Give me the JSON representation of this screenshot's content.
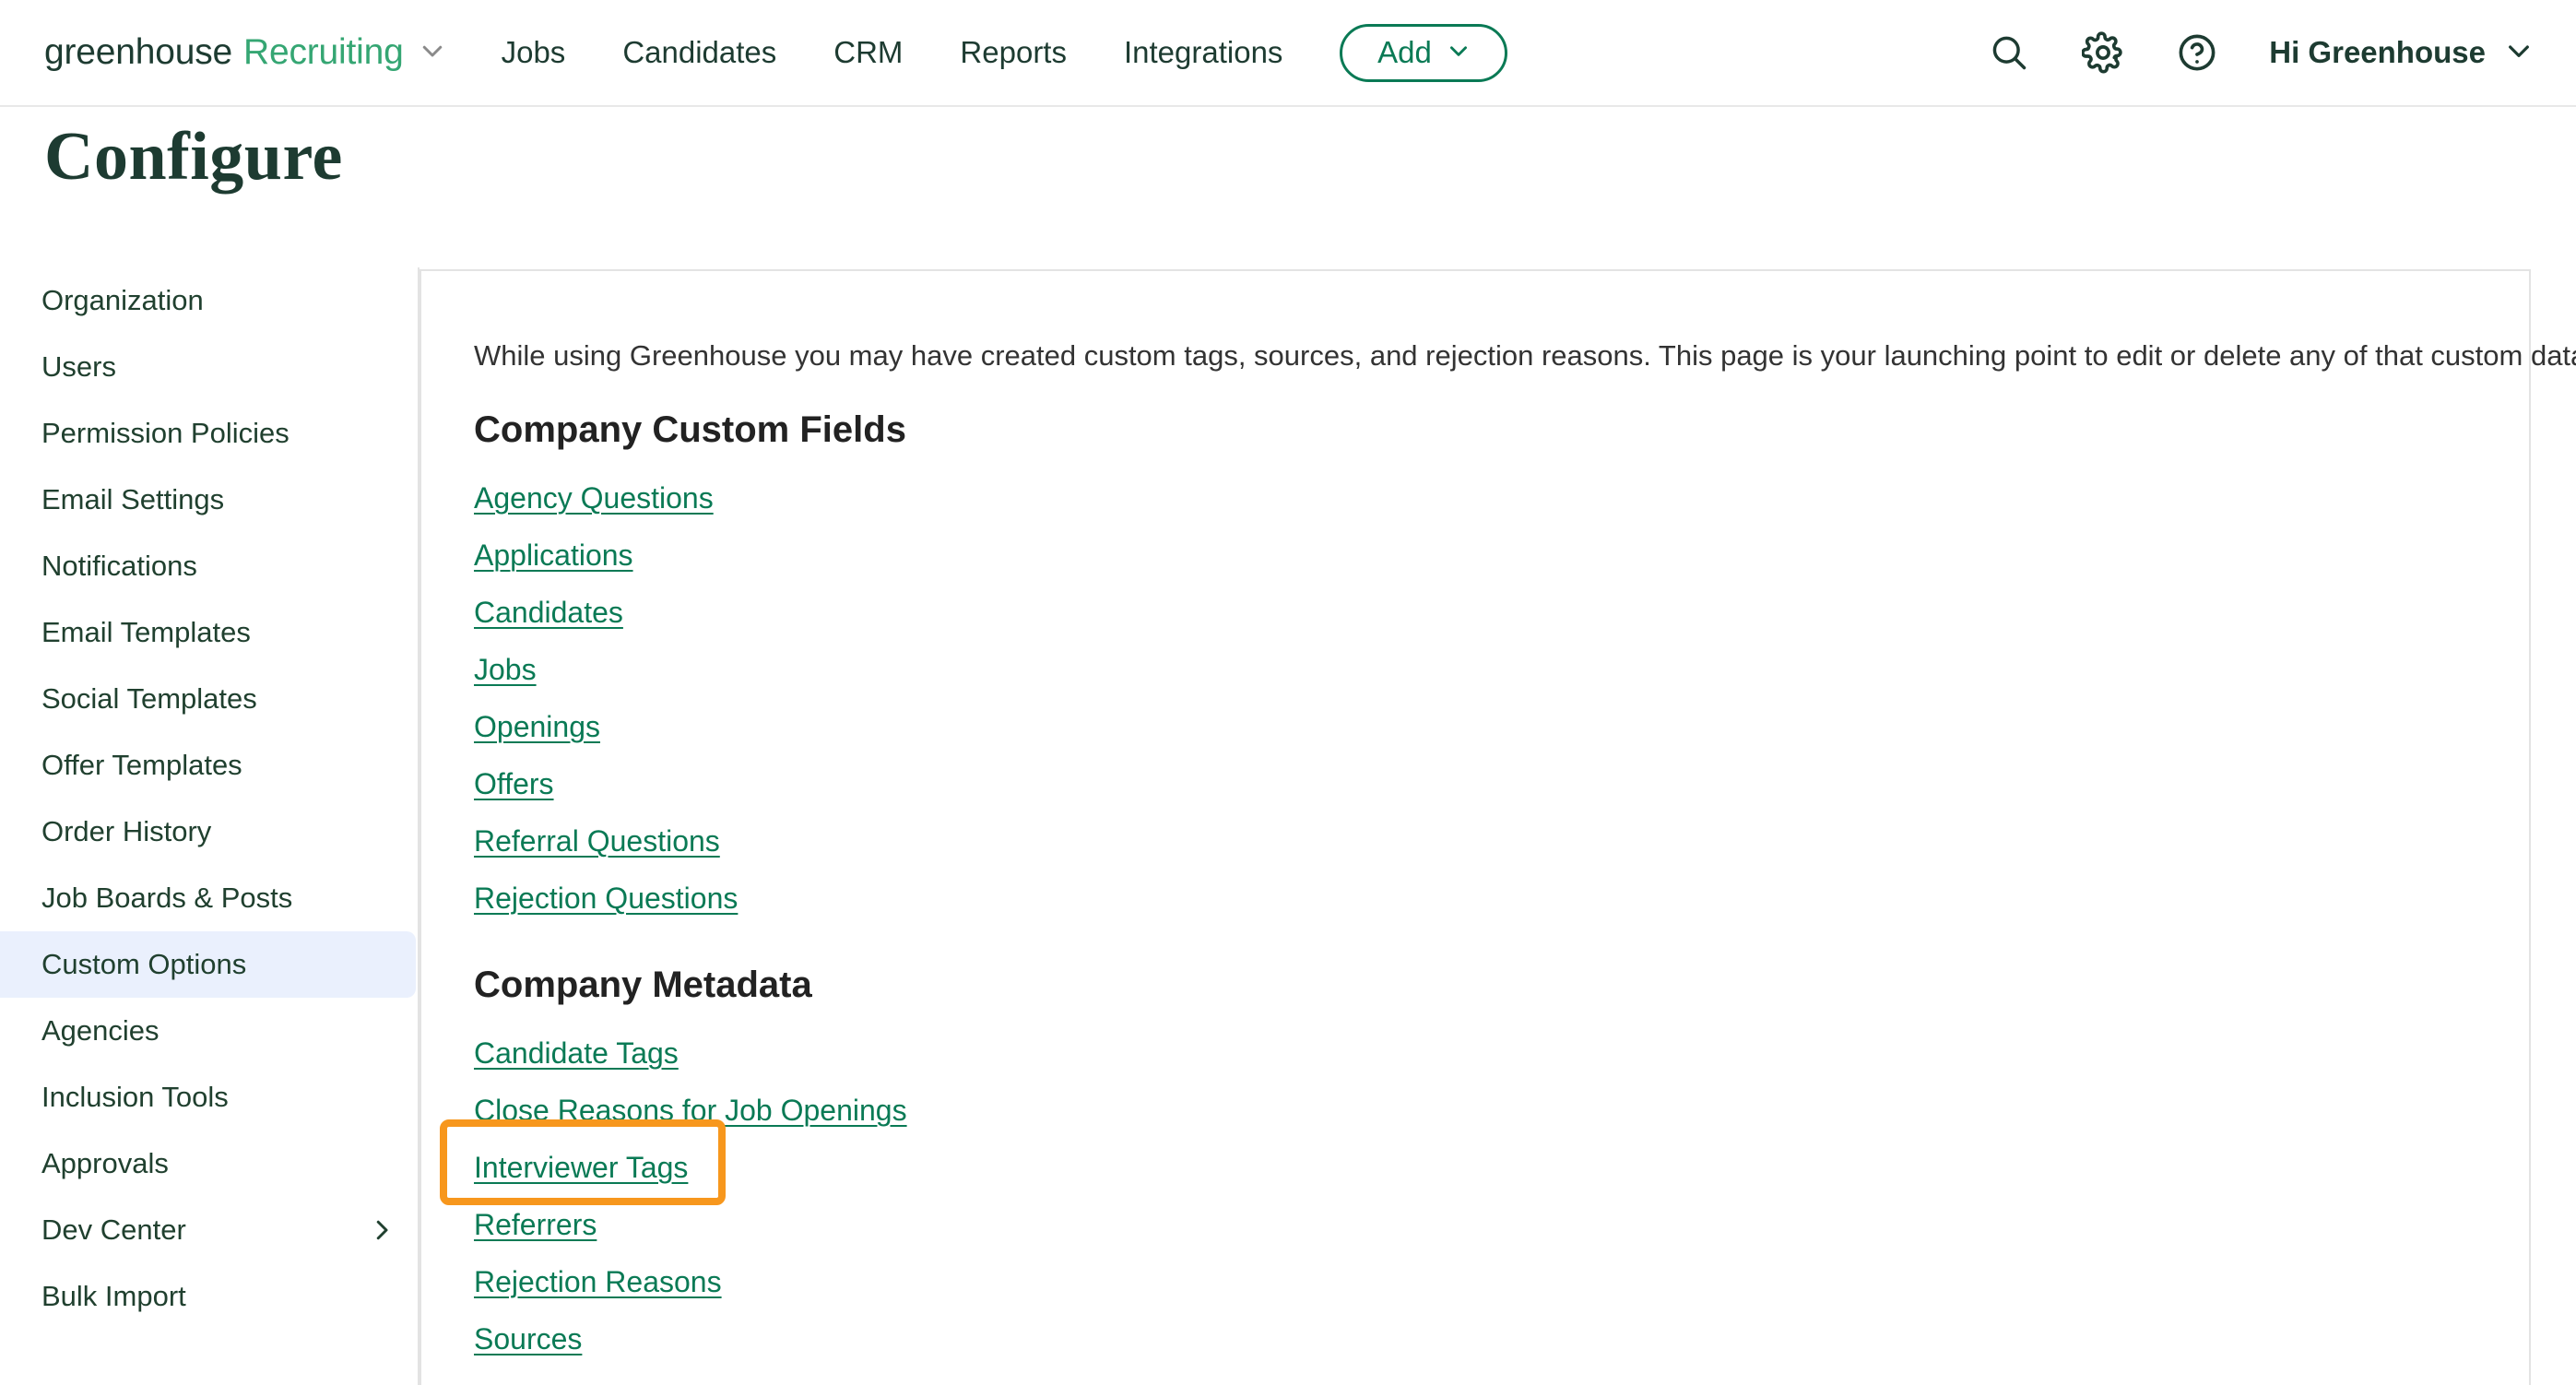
{
  "topnav": {
    "brand_primary": "greenhouse",
    "brand_secondary": "Recruiting",
    "brand_caret_icon": "chevron-down-icon",
    "links": [
      {
        "label": "Jobs"
      },
      {
        "label": "Candidates"
      },
      {
        "label": "CRM"
      },
      {
        "label": "Reports"
      },
      {
        "label": "Integrations"
      }
    ],
    "add_button": {
      "label": "Add",
      "caret_icon": "chevron-down-icon"
    },
    "search_icon": "search-icon",
    "gear_icon": "gear-icon",
    "help_icon": "question-circle-icon",
    "greeting": "Hi Greenhouse",
    "greeting_caret_icon": "chevron-down-icon"
  },
  "page": {
    "title": "Configure"
  },
  "sidebar": {
    "items": [
      {
        "label": "Organization",
        "active": false,
        "chevron": false
      },
      {
        "label": "Users",
        "active": false,
        "chevron": false
      },
      {
        "label": "Permission Policies",
        "active": false,
        "chevron": false
      },
      {
        "label": "Email Settings",
        "active": false,
        "chevron": false
      },
      {
        "label": "Notifications",
        "active": false,
        "chevron": false
      },
      {
        "label": "Email Templates",
        "active": false,
        "chevron": false
      },
      {
        "label": "Social Templates",
        "active": false,
        "chevron": false
      },
      {
        "label": "Offer Templates",
        "active": false,
        "chevron": false
      },
      {
        "label": "Order History",
        "active": false,
        "chevron": false
      },
      {
        "label": "Job Boards & Posts",
        "active": false,
        "chevron": false
      },
      {
        "label": "Custom Options",
        "active": true,
        "chevron": false
      },
      {
        "label": "Agencies",
        "active": false,
        "chevron": false
      },
      {
        "label": "Inclusion Tools",
        "active": false,
        "chevron": false
      },
      {
        "label": "Approvals",
        "active": false,
        "chevron": false
      },
      {
        "label": "Dev Center",
        "active": false,
        "chevron": true
      },
      {
        "label": "Bulk Import",
        "active": false,
        "chevron": false
      }
    ]
  },
  "main": {
    "intro": "While using Greenhouse you may have created custom tags, sources, and rejection reasons. This page is your launching point to edit or delete any of that custom data.",
    "section1": {
      "heading": "Company Custom Fields",
      "links": [
        "Agency Questions",
        "Applications",
        "Candidates",
        "Jobs",
        "Openings",
        "Offers",
        "Referral Questions",
        "Rejection Questions"
      ]
    },
    "section2": {
      "heading": "Company Metadata",
      "links": [
        "Candidate Tags",
        "Close Reasons for Job Openings",
        "Interviewer Tags",
        "Referrers",
        "Rejection Reasons",
        "Sources"
      ]
    }
  },
  "annotation": {
    "target_label": "Interviewer Tags",
    "color": "#F7971D"
  },
  "colors": {
    "brand_dark_green": "#1D3B31",
    "brand_light_green": "#35A673",
    "link_green": "#0A7A55",
    "sidebar_active_bg": "#EAF0FD",
    "panel_border": "#E3E3E3",
    "annotation_orange": "#F7971D"
  }
}
